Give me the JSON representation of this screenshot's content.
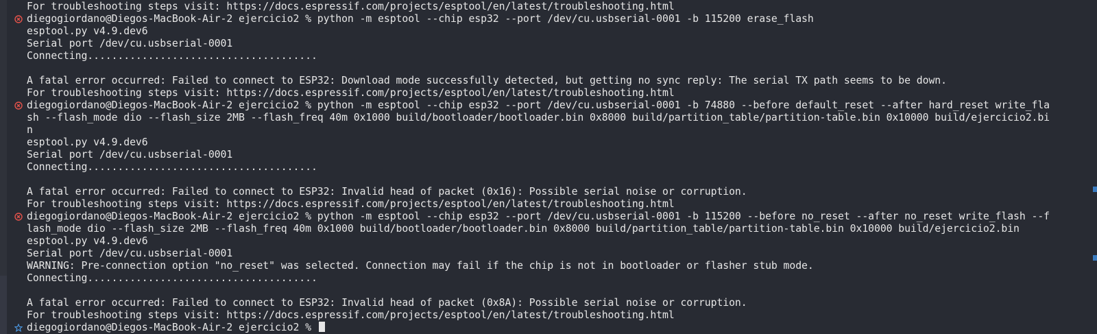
{
  "terminal": {
    "colors": {
      "background": "#282b33",
      "text": "#e6e6e6",
      "error_marker": "#e5534b",
      "info_marker": "#4c9ae6"
    },
    "lines": [
      {
        "text": "For troubleshooting steps visit: https://docs.espressif.com/projects/esptool/en/latest/troubleshooting.html",
        "marker": null
      },
      {
        "text": "diegogiordano@Diegos-MacBook-Air-2 ejercicio2 % python -m esptool --chip esp32 --port /dev/cu.usbserial-0001 -b 115200 erase_flash",
        "marker": "error"
      },
      {
        "text": "esptool.py v4.9.dev6",
        "marker": null
      },
      {
        "text": "Serial port /dev/cu.usbserial-0001",
        "marker": null
      },
      {
        "text": "Connecting......................................",
        "marker": null
      },
      {
        "text": "",
        "marker": null
      },
      {
        "text": "A fatal error occurred: Failed to connect to ESP32: Download mode successfully detected, but getting no sync reply: The serial TX path seems to be down.",
        "marker": null
      },
      {
        "text": "For troubleshooting steps visit: https://docs.espressif.com/projects/esptool/en/latest/troubleshooting.html",
        "marker": null
      },
      {
        "text": "diegogiordano@Diegos-MacBook-Air-2 ejercicio2 % python -m esptool --chip esp32 --port /dev/cu.usbserial-0001 -b 74880 --before default_reset --after hard_reset write_fla",
        "marker": "error"
      },
      {
        "text": "sh --flash_mode dio --flash_size 2MB --flash_freq 40m 0x1000 build/bootloader/bootloader.bin 0x8000 build/partition_table/partition-table.bin 0x10000 build/ejercicio2.bi",
        "marker": null
      },
      {
        "text": "n",
        "marker": null
      },
      {
        "text": "esptool.py v4.9.dev6",
        "marker": null
      },
      {
        "text": "Serial port /dev/cu.usbserial-0001",
        "marker": null
      },
      {
        "text": "Connecting......................................",
        "marker": null
      },
      {
        "text": "",
        "marker": null
      },
      {
        "text": "A fatal error occurred: Failed to connect to ESP32: Invalid head of packet (0x16): Possible serial noise or corruption.",
        "marker": null
      },
      {
        "text": "For troubleshooting steps visit: https://docs.espressif.com/projects/esptool/en/latest/troubleshooting.html",
        "marker": null
      },
      {
        "text": "diegogiordano@Diegos-MacBook-Air-2 ejercicio2 % python -m esptool --chip esp32 --port /dev/cu.usbserial-0001 -b 115200 --before no_reset --after no_reset write_flash --f",
        "marker": "error"
      },
      {
        "text": "lash_mode dio --flash_size 2MB --flash_freq 40m 0x1000 build/bootloader/bootloader.bin 0x8000 build/partition_table/partition-table.bin 0x10000 build/ejercicio2.bin",
        "marker": null
      },
      {
        "text": "esptool.py v4.9.dev6",
        "marker": null
      },
      {
        "text": "Serial port /dev/cu.usbserial-0001",
        "marker": null
      },
      {
        "text": "WARNING: Pre-connection option \"no_reset\" was selected. Connection may fail if the chip is not in bootloader or flasher stub mode.",
        "marker": null
      },
      {
        "text": "Connecting......................................",
        "marker": null
      },
      {
        "text": "",
        "marker": null
      },
      {
        "text": "A fatal error occurred: Failed to connect to ESP32: Invalid head of packet (0x8A): Possible serial noise or corruption.",
        "marker": null
      },
      {
        "text": "For troubleshooting steps visit: https://docs.espressif.com/projects/esptool/en/latest/troubleshooting.html",
        "marker": null
      },
      {
        "text": "diegogiordano@Diegos-MacBook-Air-2 ejercicio2 % ",
        "marker": "info",
        "cursor": true
      }
    ]
  }
}
